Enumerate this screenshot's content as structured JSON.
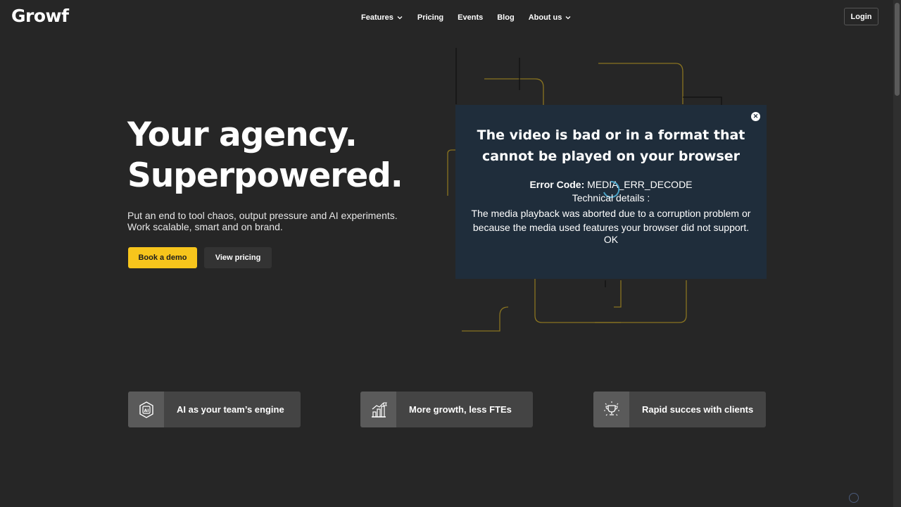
{
  "header": {
    "logo": "Growf",
    "nav": [
      {
        "label": "Features",
        "dropdown": true
      },
      {
        "label": "Pricing",
        "dropdown": false
      },
      {
        "label": "Events",
        "dropdown": false
      },
      {
        "label": "Blog",
        "dropdown": false
      },
      {
        "label": "About us",
        "dropdown": true
      }
    ],
    "login_label": "Login"
  },
  "hero": {
    "title_line1": "Your agency.",
    "title_line2": "Superpowered.",
    "subtitle_line1": "Put an end to tool chaos, output pressure and AI experiments.",
    "subtitle_line2": "Work scalable, smart and on brand.",
    "primary_button": "Book a demo",
    "secondary_button": "View pricing"
  },
  "video_error": {
    "title_line1": "The video is bad or in a format that",
    "title_line2": "cannot be played on your browser",
    "code_label": "Error Code:",
    "code_value": "MEDIA_ERR_DECODE",
    "tech_label": "Technical details :",
    "message_line1": "The media playback was aborted due to a corruption problem or",
    "message_line2": "because the media used features your browser did not support.",
    "ok_label": "OK"
  },
  "features": [
    {
      "label": "AI as your team’s engine",
      "icon": "ai-chip-icon"
    },
    {
      "label": "More growth, less FTEs",
      "icon": "growth-chart-icon"
    },
    {
      "label": "Rapid succes with clients",
      "icon": "trophy-icon"
    }
  ],
  "colors": {
    "background": "#262626",
    "accent_yellow": "#f7c51c",
    "overlay": "#1f2d3b",
    "feature_box": "#444444"
  }
}
